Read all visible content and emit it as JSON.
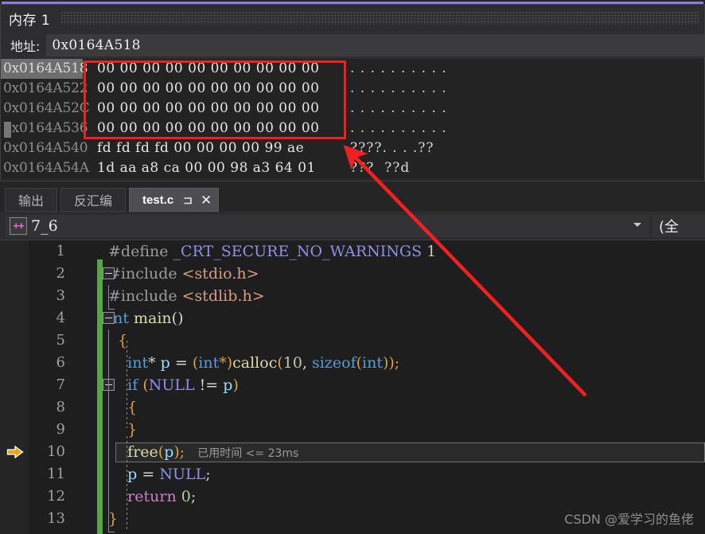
{
  "theme": {
    "accent": "#8a7de0",
    "annotation_red": "#f02020",
    "exec_arrow": "#e8a317",
    "change_bar_green": "#57a64a"
  },
  "memory_window": {
    "title": "内存 1",
    "address_label": "地址:",
    "address_value": "0x0164A518",
    "rows": [
      {
        "address": "0x0164A518",
        "bytes": "00 00 00 00 00 00 00 00 00 00",
        "ascii": ". . . . . . . . . ."
      },
      {
        "address": "0x0164A522",
        "bytes": "00 00 00 00 00 00 00 00 00 00",
        "ascii": ". . . . . . . . . ."
      },
      {
        "address": "0x0164A52C",
        "bytes": "00 00 00 00 00 00 00 00 00 00",
        "ascii": ". . . . . . . . . ."
      },
      {
        "address": "0x0164A536",
        "bytes": "00 00 00 00 00 00 00 00 00 00",
        "ascii": ". . . . . . . . . ."
      },
      {
        "address": "0x0164A540",
        "bytes": "fd fd fd fd 00 00 00 00 99 ae",
        "ascii": "????. . . .??"
      },
      {
        "address": "0x0164A54A",
        "bytes": "1d aa a8 ca 00 00 98 a3 64 01",
        "ascii": "???  ??d"
      }
    ]
  },
  "tabs": [
    {
      "label": "输出",
      "active": false
    },
    {
      "label": "反汇编",
      "active": false
    },
    {
      "label": "test.c",
      "active": true,
      "pin_icon": "⊐",
      "close_icon": "✕"
    }
  ],
  "navbar": {
    "project_icon": "++",
    "project_name": "7_6",
    "dropdown_arrow_icon": "chevron-down",
    "scope_value": "(全"
  },
  "editor": {
    "lines": [
      {
        "n": "1",
        "segments": [
          {
            "t": "#define ",
            "c": "pp"
          },
          {
            "t": "_CRT_SECURE_NO_WARNINGS ",
            "c": "mac"
          },
          {
            "t": "1",
            "c": "num"
          }
        ]
      },
      {
        "n": "2",
        "segments": [
          {
            "t": "#include ",
            "c": "pp"
          },
          {
            "t": "<stdio.h>",
            "c": "hdr"
          }
        ]
      },
      {
        "n": "3",
        "segments": [
          {
            "t": "#include ",
            "c": "pp"
          },
          {
            "t": "<stdlib.h>",
            "c": "hdr"
          }
        ]
      },
      {
        "n": "4",
        "segments": [
          {
            "t": "int ",
            "c": "k"
          },
          {
            "t": "main",
            "c": "fn"
          },
          {
            "t": "()",
            "c": "pl"
          }
        ]
      },
      {
        "n": "5",
        "segments": [
          {
            "t": "  {",
            "c": "brc"
          }
        ]
      },
      {
        "n": "6",
        "segments": [
          {
            "t": "    ",
            "c": "pl"
          },
          {
            "t": "int",
            "c": "k"
          },
          {
            "t": "* ",
            "c": "pl"
          },
          {
            "t": "p",
            "c": "id"
          },
          {
            "t": " = ",
            "c": "pl"
          },
          {
            "t": "(",
            "c": "brc"
          },
          {
            "t": "int",
            "c": "k"
          },
          {
            "t": "*)",
            "c": "brc"
          },
          {
            "t": "calloc",
            "c": "fn"
          },
          {
            "t": "(",
            "c": "brc"
          },
          {
            "t": "10",
            "c": "num"
          },
          {
            "t": ", ",
            "c": "pl"
          },
          {
            "t": "sizeof",
            "c": "k"
          },
          {
            "t": "(",
            "c": "brc"
          },
          {
            "t": "int",
            "c": "k"
          },
          {
            "t": "));",
            "c": "brc"
          }
        ]
      },
      {
        "n": "7",
        "segments": [
          {
            "t": "    ",
            "c": "pl"
          },
          {
            "t": "if ",
            "c": "k"
          },
          {
            "t": "(",
            "c": "brc"
          },
          {
            "t": "NULL",
            "c": "mac"
          },
          {
            "t": " != ",
            "c": "pl"
          },
          {
            "t": "p",
            "c": "id"
          },
          {
            "t": ")",
            "c": "brc"
          }
        ]
      },
      {
        "n": "8",
        "segments": [
          {
            "t": "    {",
            "c": "brc"
          }
        ]
      },
      {
        "n": "9",
        "segments": [
          {
            "t": "    }",
            "c": "brc"
          }
        ]
      },
      {
        "n": "10",
        "segments": [
          {
            "t": "    ",
            "c": "pl"
          },
          {
            "t": "free",
            "c": "fn"
          },
          {
            "t": "(",
            "c": "brc"
          },
          {
            "t": "p",
            "c": "id"
          },
          {
            "t": ");",
            "c": "brc"
          }
        ],
        "elapsed": "已用时间 <= 23ms",
        "current": true
      },
      {
        "n": "11",
        "segments": [
          {
            "t": "    ",
            "c": "pl"
          },
          {
            "t": "p",
            "c": "id"
          },
          {
            "t": " = ",
            "c": "pl"
          },
          {
            "t": "NULL",
            "c": "mac"
          },
          {
            "t": ";",
            "c": "pl"
          }
        ]
      },
      {
        "n": "12",
        "segments": [
          {
            "t": "    ",
            "c": "pl"
          },
          {
            "t": "return ",
            "c": "ret"
          },
          {
            "t": "0",
            "c": "num"
          },
          {
            "t": ";",
            "c": "pl"
          }
        ]
      },
      {
        "n": "13",
        "segments": [
          {
            "t": "}",
            "c": "brc"
          }
        ]
      }
    ]
  },
  "watermark": "CSDN @爱学习的鱼佬",
  "annotations": {
    "highlight_box_icon": "red-rectangle",
    "pointer_icon": "red-arrow"
  }
}
